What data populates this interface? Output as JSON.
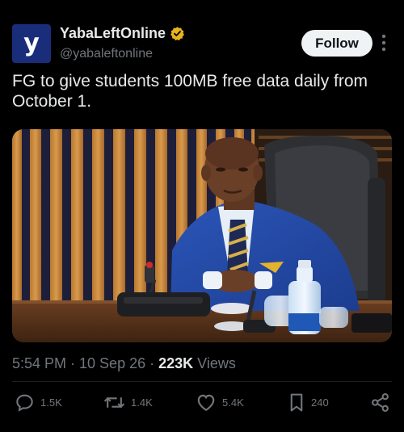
{
  "post": {
    "author": {
      "display_name": "YabaLeftOnline",
      "handle": "@yabaleftonline",
      "avatar_letter": "y",
      "avatar_color": "#1a2d7a",
      "verified_badge_color": "#e8b41c"
    },
    "follow_label": "Follow",
    "text": "FG to give students 100MB free data daily from October 1.",
    "timestamp": "5:54 PM · 10 Sep 26 · ",
    "views_count": "223K",
    "views_label": " Views",
    "actions": {
      "replies": "1.5K",
      "reposts": "1.4K",
      "likes": "5.4K",
      "bookmarks": "240"
    }
  },
  "theme": {
    "background": "#000000",
    "text_primary": "#e7e9ea",
    "text_secondary": "#71767b"
  },
  "icons": [
    "verified-badge-icon",
    "more-icon",
    "reply-icon",
    "repost-icon",
    "like-icon",
    "bookmark-icon",
    "share-icon"
  ]
}
